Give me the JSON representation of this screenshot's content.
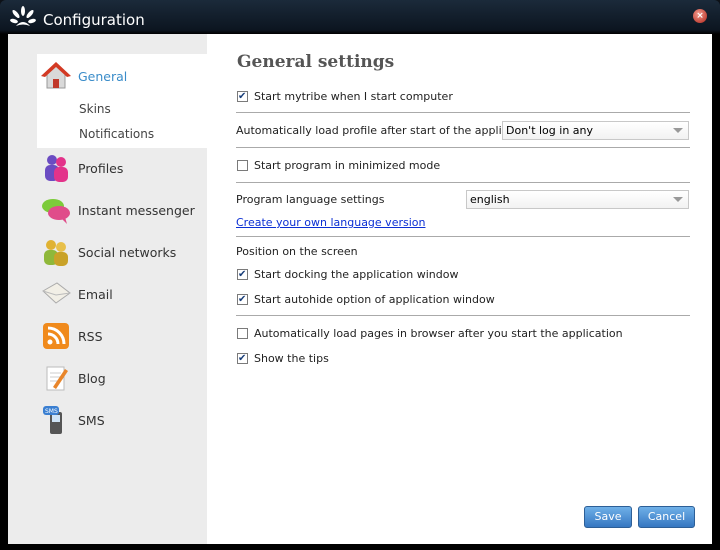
{
  "window": {
    "title": "Configuration",
    "close_glyph": "×"
  },
  "sidebar": {
    "items": [
      {
        "label": "General",
        "icon": "home-icon",
        "active": true
      },
      {
        "label": "Profiles",
        "icon": "users-icon"
      },
      {
        "label": "Instant messenger",
        "icon": "chat-bubbles-icon"
      },
      {
        "label": "Social networks",
        "icon": "social-people-icon"
      },
      {
        "label": "Email",
        "icon": "envelope-icon"
      },
      {
        "label": "RSS",
        "icon": "rss-icon"
      },
      {
        "label": "Blog",
        "icon": "notepad-icon"
      },
      {
        "label": "SMS",
        "icon": "mobile-phone-icon"
      }
    ],
    "sub_items": [
      {
        "label": "Skins"
      },
      {
        "label": "Notifications"
      }
    ]
  },
  "main": {
    "heading": "General settings",
    "start_on_boot": {
      "label": "Start mytribe when I start computer",
      "checked": true
    },
    "auto_load_profile": {
      "label": "Automatically load profile after start of the application",
      "value": "Don't log in any"
    },
    "start_minimized": {
      "label": "Start program in minimized mode",
      "checked": false
    },
    "language": {
      "label": "Program language settings",
      "value": "english"
    },
    "create_language_link": "Create your own language version",
    "position_label": "Position on the screen",
    "docking": {
      "label": "Start docking the application window",
      "checked": true
    },
    "autohide": {
      "label": "Start autohide option of application window",
      "checked": true
    },
    "auto_load_pages": {
      "label": "Automatically load pages in browser after you start the application",
      "checked": false
    },
    "show_tips": {
      "label": "Show the tips",
      "checked": true
    }
  },
  "buttons": {
    "save": "Save",
    "cancel": "Cancel"
  },
  "colors": {
    "active_nav": "#3a8cc9",
    "link": "#0b2fd4",
    "button": "#3677c1",
    "title_bar": "#0c1520"
  }
}
